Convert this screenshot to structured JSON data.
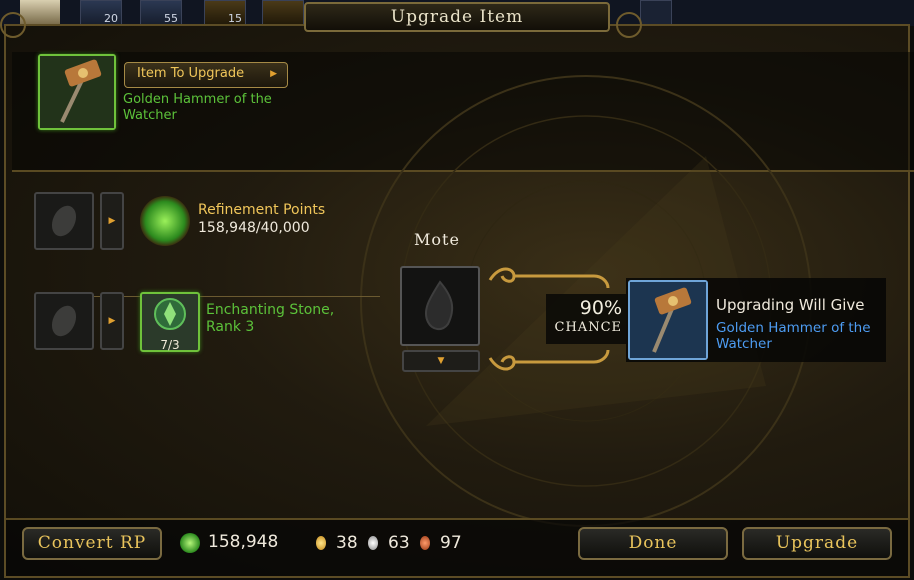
{
  "hotbar": {
    "counts": [
      "20",
      "55",
      "15"
    ]
  },
  "window": {
    "title": "Upgrade Item"
  },
  "item_to_upgrade": {
    "button_label": "Item To Upgrade",
    "item_name": "Golden Hammer of the Watcher"
  },
  "refinement": {
    "label": "Refinement Points",
    "value": "158,948/40,000"
  },
  "enchanting_stone": {
    "name": "Enchanting Stone, Rank 3",
    "count": "7/3"
  },
  "mote": {
    "label": "Mote"
  },
  "chance": {
    "percent": "90%",
    "label": "Chance"
  },
  "result": {
    "heading": "Upgrading Will Give",
    "item_name": "Golden Hammer of the Watcher"
  },
  "footer": {
    "convert_label": "Convert RP",
    "rp_total": "158,948",
    "gold": "38",
    "silver": "63",
    "copper": "97",
    "done_label": "Done",
    "upgrade_label": "Upgrade"
  },
  "colors": {
    "gold_text": "#f0c65a",
    "green_text": "#5cc23a",
    "blue_text": "#4d9cf2",
    "frame": "#5c4c25"
  },
  "icons": [
    "hammer-icon",
    "refinement-icon",
    "enchant-stone-icon",
    "mote-icon",
    "empty-slot-icon",
    "rp-icon",
    "gold-coin-icon",
    "silver-coin-icon",
    "copper-coin-icon"
  ]
}
